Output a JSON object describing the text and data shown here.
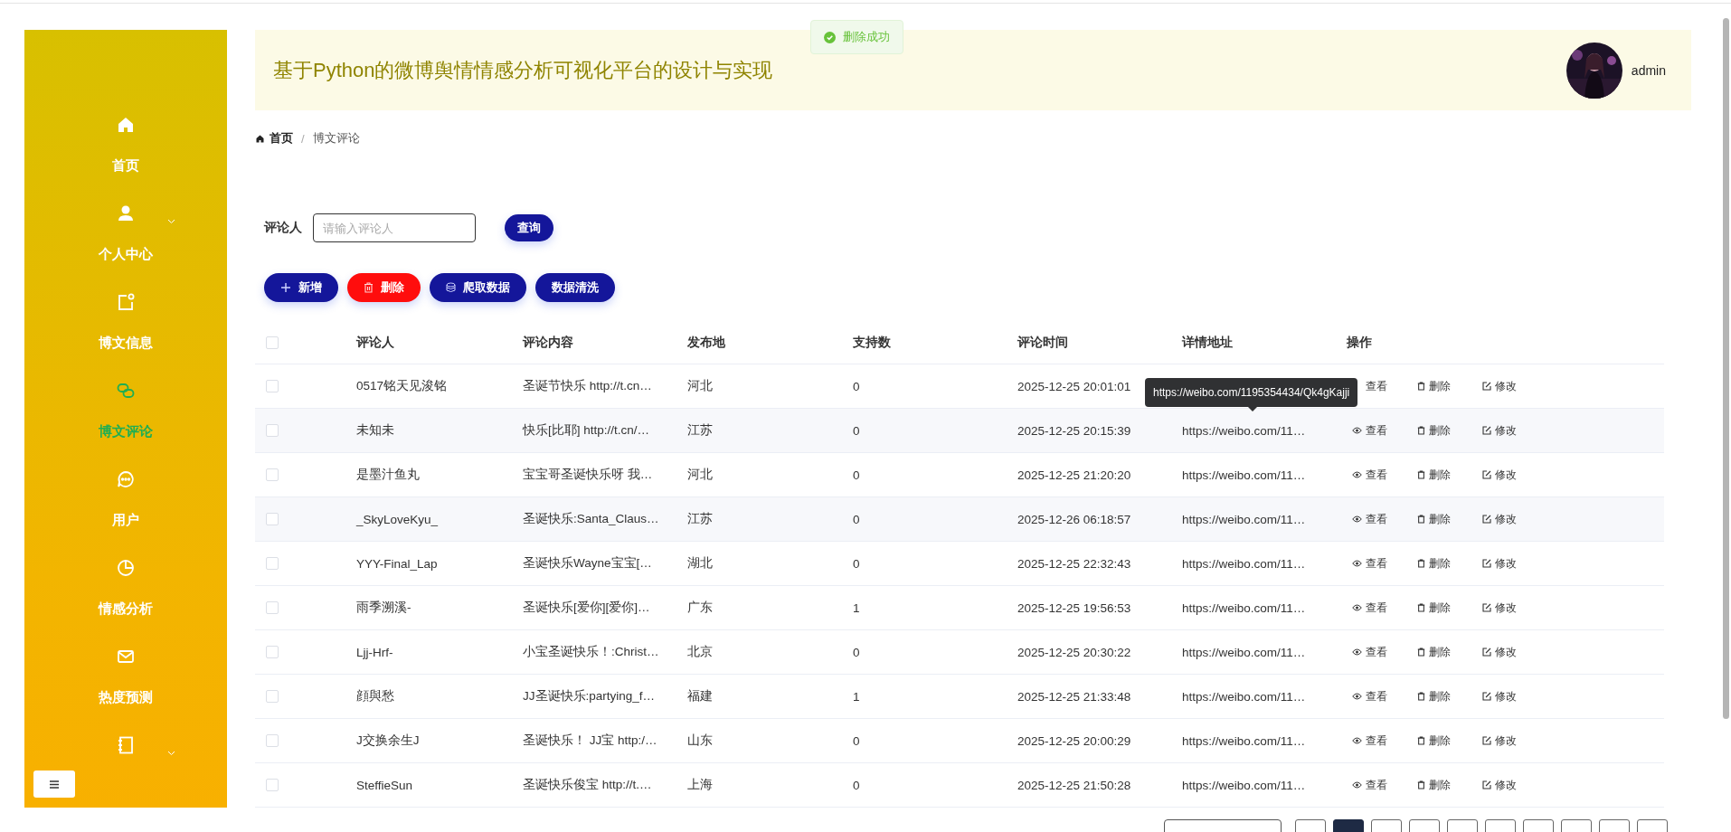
{
  "sidebar": {
    "items": [
      {
        "label": "首页",
        "selected": false,
        "expandable": false
      },
      {
        "label": "个人中心",
        "selected": false,
        "expandable": true
      },
      {
        "label": "博文信息",
        "selected": false,
        "expandable": false
      },
      {
        "label": "博文评论",
        "selected": true,
        "expandable": false
      },
      {
        "label": "用户",
        "selected": false,
        "expandable": false
      },
      {
        "label": "情感分析",
        "selected": false,
        "expandable": false
      },
      {
        "label": "热度预测",
        "selected": false,
        "expandable": false
      },
      {
        "selected": false,
        "expandable": true
      }
    ]
  },
  "toast": {
    "text": "删除成功"
  },
  "header": {
    "title": "基于Python的微博舆情情感分析可视化平台的设计与实现",
    "user": "admin"
  },
  "breadcrumb_separator": "/",
  "breadcrumb": [
    {
      "label": "首页",
      "current": false
    },
    {
      "label": "博文评论",
      "current": true
    }
  ],
  "search": {
    "label": "评论人",
    "placeholder": "请输入评论人",
    "button": "查询"
  },
  "actions": [
    {
      "label": "新增",
      "kind": "add"
    },
    {
      "label": "删除",
      "kind": "delete"
    },
    {
      "label": "爬取数据",
      "kind": "crawl"
    },
    {
      "label": "数据清洗",
      "kind": "clean"
    }
  ],
  "table": {
    "header_checked": false,
    "columns": [
      "评论人",
      "评论内容",
      "发布地",
      "支持数",
      "评论时间",
      "详情地址",
      "操作"
    ],
    "rows": [
      {
        "checked": false,
        "cells": [
          "0517铭天见浚铭",
          "圣诞节快乐 http://t.cn…",
          "河北",
          "0",
          "2025-12-25 20:01:01",
          ""
        ],
        "actions": [
          "查看",
          "删除",
          "修改"
        ]
      },
      {
        "checked": false,
        "cells": [
          "未知未",
          "快乐[比耶] http://t.cn/…",
          "江苏",
          "0",
          "2025-12-25 20:15:39",
          "https://weibo.com/11…"
        ],
        "actions": [
          "查看",
          "删除",
          "修改"
        ]
      },
      {
        "checked": false,
        "cells": [
          "是墨汁鱼丸",
          "宝宝哥圣诞快乐呀 我…",
          "河北",
          "0",
          "2025-12-25 21:20:20",
          "https://weibo.com/11…"
        ],
        "actions": [
          "查看",
          "删除",
          "修改"
        ]
      },
      {
        "checked": false,
        "cells": [
          "_SkyLoveKyu_",
          "圣诞快乐:Santa_Claus…",
          "江苏",
          "0",
          "2025-12-26 06:18:57",
          "https://weibo.com/11…"
        ],
        "actions": [
          "查看",
          "删除",
          "修改"
        ]
      },
      {
        "checked": false,
        "cells": [
          "YYY-Final_Lap",
          "圣诞快乐Wayne宝宝[…",
          "湖北",
          "0",
          "2025-12-25 22:32:43",
          "https://weibo.com/11…"
        ],
        "actions": [
          "查看",
          "删除",
          "修改"
        ]
      },
      {
        "checked": false,
        "cells": [
          "雨季溯溪-",
          "圣诞快乐[爱你][爱你]…",
          "广东",
          "1",
          "2025-12-25 19:56:53",
          "https://weibo.com/11…"
        ],
        "actions": [
          "查看",
          "删除",
          "修改"
        ]
      },
      {
        "checked": false,
        "cells": [
          "Ljj-Hrf-",
          "小宝圣诞快乐！:Christ…",
          "北京",
          "0",
          "2025-12-25 20:30:22",
          "https://weibo.com/11…"
        ],
        "actions": [
          "查看",
          "删除",
          "修改"
        ]
      },
      {
        "checked": false,
        "cells": [
          "顔與愁",
          "JJ圣诞快乐:partying_f…",
          "福建",
          "1",
          "2025-12-25 21:33:48",
          "https://weibo.com/11…"
        ],
        "actions": [
          "查看",
          "删除",
          "修改"
        ]
      },
      {
        "checked": false,
        "cells": [
          "J交换余生J",
          "圣诞快乐！ JJ宝 http:/…",
          "山东",
          "0",
          "2025-12-25 20:00:29",
          "https://weibo.com/11…"
        ],
        "actions": [
          "查看",
          "删除",
          "修改"
        ]
      },
      {
        "checked": false,
        "cells": [
          "SteffieSun",
          "圣诞快乐俊宝 http://t.…",
          "上海",
          "0",
          "2025-12-25 21:50:28",
          "https://weibo.com/11…"
        ],
        "actions": [
          "查看",
          "删除",
          "修改"
        ]
      }
    ]
  },
  "tooltip": {
    "text": "https://weibo.com/1195354434/Qk4gKajji"
  },
  "pagination": {
    "pages": [
      {
        "selected": false
      },
      {
        "selected": true
      },
      {
        "selected": false
      },
      {
        "selected": false
      },
      {
        "selected": false
      },
      {
        "selected": false
      },
      {
        "selected": false
      },
      {
        "selected": false
      },
      {
        "selected": false
      },
      {
        "selected": false
      }
    ]
  }
}
